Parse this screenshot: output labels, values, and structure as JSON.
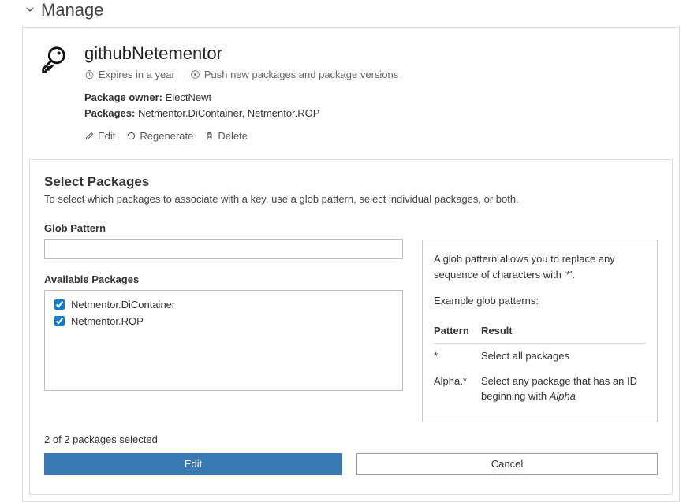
{
  "header": {
    "title": "Manage"
  },
  "key": {
    "name": "githubNetementor",
    "expires": "Expires in a year",
    "push": "Push new packages and package versions",
    "owner_label": "Package owner:",
    "owner_value": "ElectNewt",
    "packages_label": "Packages:",
    "packages_value": "Netmentor.DiContainer, Netmentor.ROP",
    "actions": {
      "edit": "Edit",
      "regenerate": "Regenerate",
      "delete": "Delete"
    }
  },
  "select": {
    "title": "Select Packages",
    "desc": "To select which packages to associate with a key, use a glob pattern, select individual packages, or both.",
    "glob_label": "Glob Pattern",
    "glob_value": "",
    "avail_label": "Available Packages",
    "packages": [
      {
        "name": "Netmentor.DiContainer",
        "checked": true
      },
      {
        "name": "Netmentor.ROP",
        "checked": true
      }
    ],
    "count": "2 of 2 packages selected"
  },
  "hint": {
    "intro": "A glob pattern allows you to replace any sequence of characters with '*'.",
    "example_label": "Example glob patterns:",
    "th_pattern": "Pattern",
    "th_result": "Result",
    "rows": [
      {
        "pattern": "*",
        "result": "Select all packages"
      },
      {
        "pattern": "Alpha.*",
        "result_prefix": "Select any package that has an ID beginning with ",
        "result_em": "Alpha"
      }
    ]
  },
  "buttons": {
    "edit": "Edit",
    "cancel": "Cancel"
  }
}
